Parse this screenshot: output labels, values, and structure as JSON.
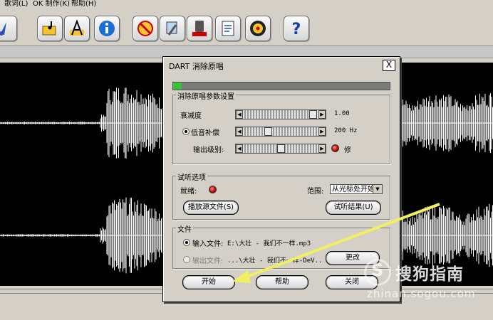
{
  "menu": {
    "items": [
      "歌词(L)",
      "OK 制作(K)",
      "帮助(H)"
    ]
  },
  "toolbar": {
    "icons": [
      "tuning-fork-icon",
      "folder-note-icon",
      "text-a-icon",
      "info-icon",
      "no-vocal-icon",
      "tool-icon",
      "record-icon",
      "notes-icon",
      "cd-icon",
      "help-icon"
    ],
    "help_glyph": "?"
  },
  "dialog": {
    "title": "DART 消除原唱",
    "close": "X",
    "progress": 0.04,
    "params": {
      "legend": "消除原唱参数设置",
      "attenuation": {
        "label": "衰减度",
        "value": "1.00",
        "level": 0.98
      },
      "bass": {
        "label": "低音补偿",
        "value": "200 Hz",
        "level": 0.32,
        "checked": true
      },
      "output": {
        "label": "输出级别:",
        "level": 0.5,
        "suffix": "修"
      }
    },
    "preview": {
      "legend": "试听选项",
      "ready_label": "就绪:",
      "range_label": "范围:",
      "range_value": "从光标处开始",
      "play_source": "播放源文件(S)",
      "preview_result": "试听结果(U)"
    },
    "file": {
      "legend": "文件",
      "input_label": "输入文件:",
      "input_value": "E:\\大壮 - 我们不一样.mp3",
      "output_label": "输出文件:",
      "output_value": "...\\大壮 - 我们不一样-DeV...",
      "change": "更改"
    },
    "buttons": {
      "start": "开始",
      "help": "帮助",
      "close": "关闭"
    }
  },
  "watermark": {
    "symbol": "S",
    "text": "搜狗指南",
    "url": "zhinan.sogou.com"
  },
  "colors": {
    "arrow": "#f0f060",
    "progress": "#39c13a",
    "wave": "#ffffff"
  }
}
